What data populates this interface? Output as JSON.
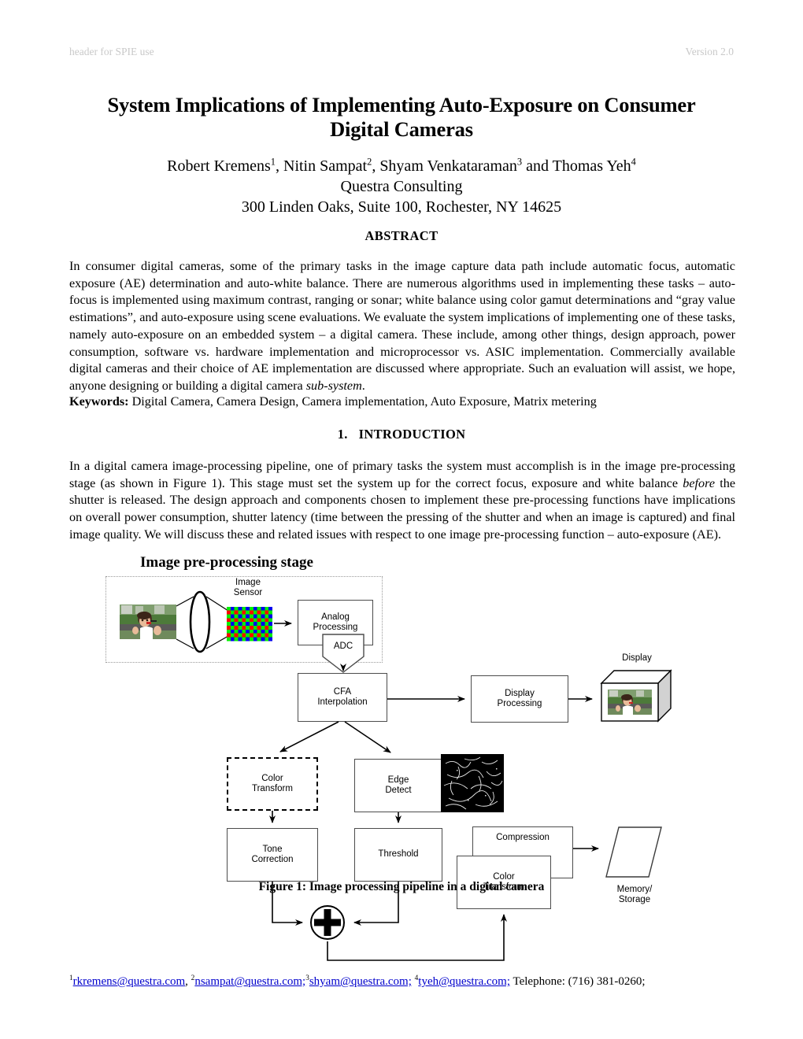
{
  "header": {
    "left": "header for SPIE use",
    "right": "Version 2.0"
  },
  "title": "System Implications of Implementing Auto-Exposure on Consumer Digital Cameras",
  "authors": {
    "line1_parts": [
      {
        "text": "Robert Kremens",
        "sup": "1"
      },
      {
        "text": ", Nitin Sampat",
        "sup": "2"
      },
      {
        "text": ", Shyam Venkataraman",
        "sup": "3"
      },
      {
        "text": " and Thomas Yeh",
        "sup": "4"
      }
    ],
    "affiliation": "Questra Consulting",
    "address": "300 Linden Oaks, Suite 100, Rochester, NY 14625"
  },
  "abstract": {
    "heading": "ABSTRACT",
    "text_before_italic": "In consumer digital cameras, some of the primary tasks in the image capture data path include automatic focus, automatic exposure (AE) determination and auto-white balance.  There are numerous algorithms used in implementing these tasks – auto-focus is implemented using maximum contrast, ranging or sonar; white balance using color gamut determinations and “gray value estimations”, and auto-exposure using scene evaluations.  We evaluate the system implications of implementing one of these tasks, namely auto-exposure on an embedded system – a digital camera.  These include, among other things, design approach, power consumption, software vs. hardware implementation and microprocessor vs. ASIC implementation.  Commercially available digital cameras and their choice of AE implementation are discussed where appropriate.  Such an evaluation will assist, we hope, anyone designing or building a digital camera ",
    "italic_word": "sub-system",
    "text_after_italic": "."
  },
  "keywords": {
    "label": "Keywords:",
    "value": " Digital Camera, Camera Design, Camera implementation, Auto Exposure, Matrix metering"
  },
  "section": {
    "number": "1.",
    "title": "INTRODUCTION"
  },
  "intro": {
    "part1": "In a digital camera image-processing pipeline, one of primary tasks the system must accomplish is in the image pre-processing stage (as shown in Figure 1).  This stage must set the system up for the correct focus, exposure and white balance ",
    "italic_word": "before",
    "part2": " the shutter is released.  The design approach and components chosen to implement these pre-processing functions have implications on overall power consumption, shutter latency (time between the pressing of the shutter and when an image is captured) and final image quality.  We will discuss these and related issues with respect to one image pre-processing function – auto-exposure (AE)."
  },
  "figure": {
    "heading": "Image pre-processing stage",
    "caption": "Figure 1: Image processing pipeline in a digital camera",
    "labels": {
      "image_sensor": "Image\nSensor",
      "display": "Display",
      "memory_storage": "Memory/\nStorage"
    },
    "nodes": [
      {
        "id": "analog-processing",
        "label": "Analog\nProcessing"
      },
      {
        "id": "adc",
        "label": "ADC"
      },
      {
        "id": "cfa-interpolation",
        "label": "CFA\nInterpolation"
      },
      {
        "id": "display-processing",
        "label": "Display\nProcessing"
      },
      {
        "id": "color-transform-1",
        "label": "Color\nTransform"
      },
      {
        "id": "edge-detect",
        "label": "Edge\nDetect"
      },
      {
        "id": "tone-correction",
        "label": "Tone\nCorrection"
      },
      {
        "id": "threshold",
        "label": "Threshold"
      },
      {
        "id": "compression",
        "label": "Compression"
      },
      {
        "id": "color-transform-2",
        "label": "Color\nTransform"
      }
    ],
    "colors": {
      "bayer_red": "#ff0000",
      "bayer_green": "#00ee00",
      "bayer_blue": "#0000ee",
      "box_stroke": "#4c4c4c",
      "dotted_stroke": "#9a9a9a"
    }
  },
  "footnote": {
    "emails": [
      {
        "sup": "1",
        "text": "rkremens@questra.com",
        "sep": ", "
      },
      {
        "sup": "2",
        "text": "nsampat@questra.com;",
        "sep": ""
      },
      {
        "sup": "3",
        "text": "shyam@questra.com;",
        "sep": " "
      },
      {
        "sup": "4",
        "text": "tyeh@questra.com;",
        "sep": " "
      }
    ],
    "tail": " Telephone: (716) 381-0260;"
  }
}
